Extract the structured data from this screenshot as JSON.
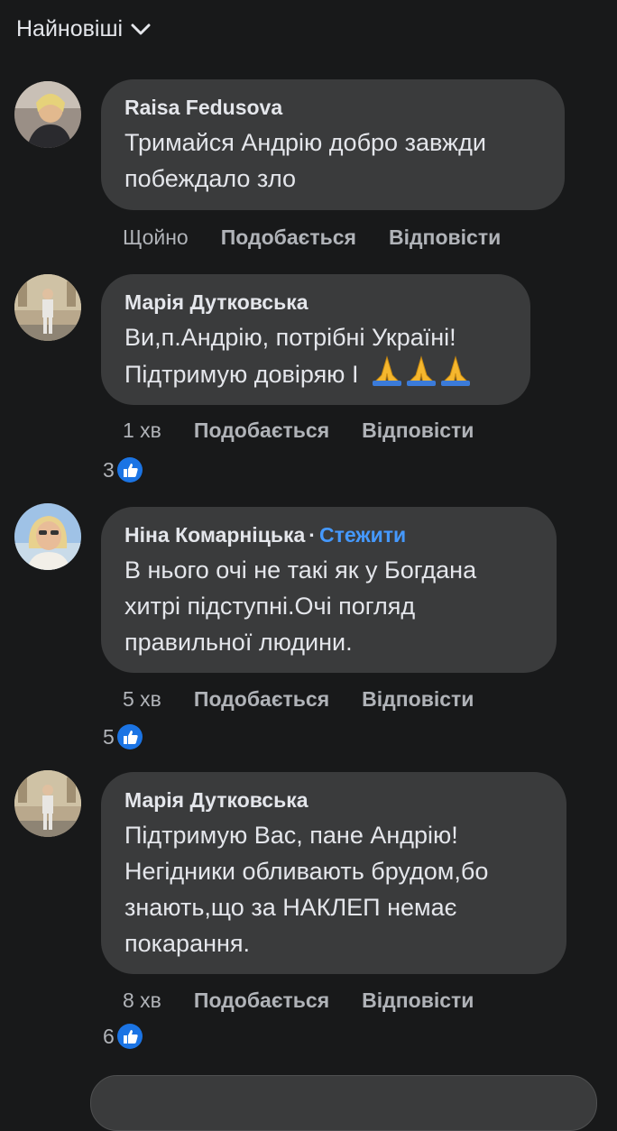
{
  "sort": {
    "label": "Найновіші"
  },
  "comments": [
    {
      "author": "Raisa Fedusova",
      "text_lines": [
        "Тримайся Андрію добро завжди",
        "побеждало зло"
      ],
      "time": "Щойно",
      "like": "Подобається",
      "reply": "Відповісти",
      "reactions": ""
    },
    {
      "author": "Марія Дутковська",
      "text_lines": [
        "Ви,п.Андрію, потрібні Україні!",
        "Підтримую довіряю І"
      ],
      "emoji": "🙏🙏🙏",
      "time": "1 хв",
      "like": "Подобається",
      "reply": "Відповісти",
      "reactions": "3"
    },
    {
      "author": "Ніна Комарніцька",
      "follow": "Стежити",
      "text_lines": [
        "В нього очі не такі як  у Богдана",
        "хитрі підступні.Очі погляд",
        "правильної людини."
      ],
      "time": "5 хв",
      "like": "Подобається",
      "reply": "Відповісти",
      "reactions": "5"
    },
    {
      "author": "Марія Дутковська",
      "text_lines": [
        "Підтримую Вас, пане Андрію!",
        "Негідники обливають брудом,бо",
        "знають,що за НАКЛЕП немає",
        "покарання."
      ],
      "time": "8 хв",
      "like": "Подобається",
      "reply": "Відповісти",
      "reactions": "6"
    }
  ],
  "colors": {
    "background": "#18191a",
    "bubble": "#3a3b3c",
    "text": "#e4e6eb",
    "secondary": "#b0b3b8",
    "link": "#4599ff",
    "like_badge": "#1b74e4"
  }
}
